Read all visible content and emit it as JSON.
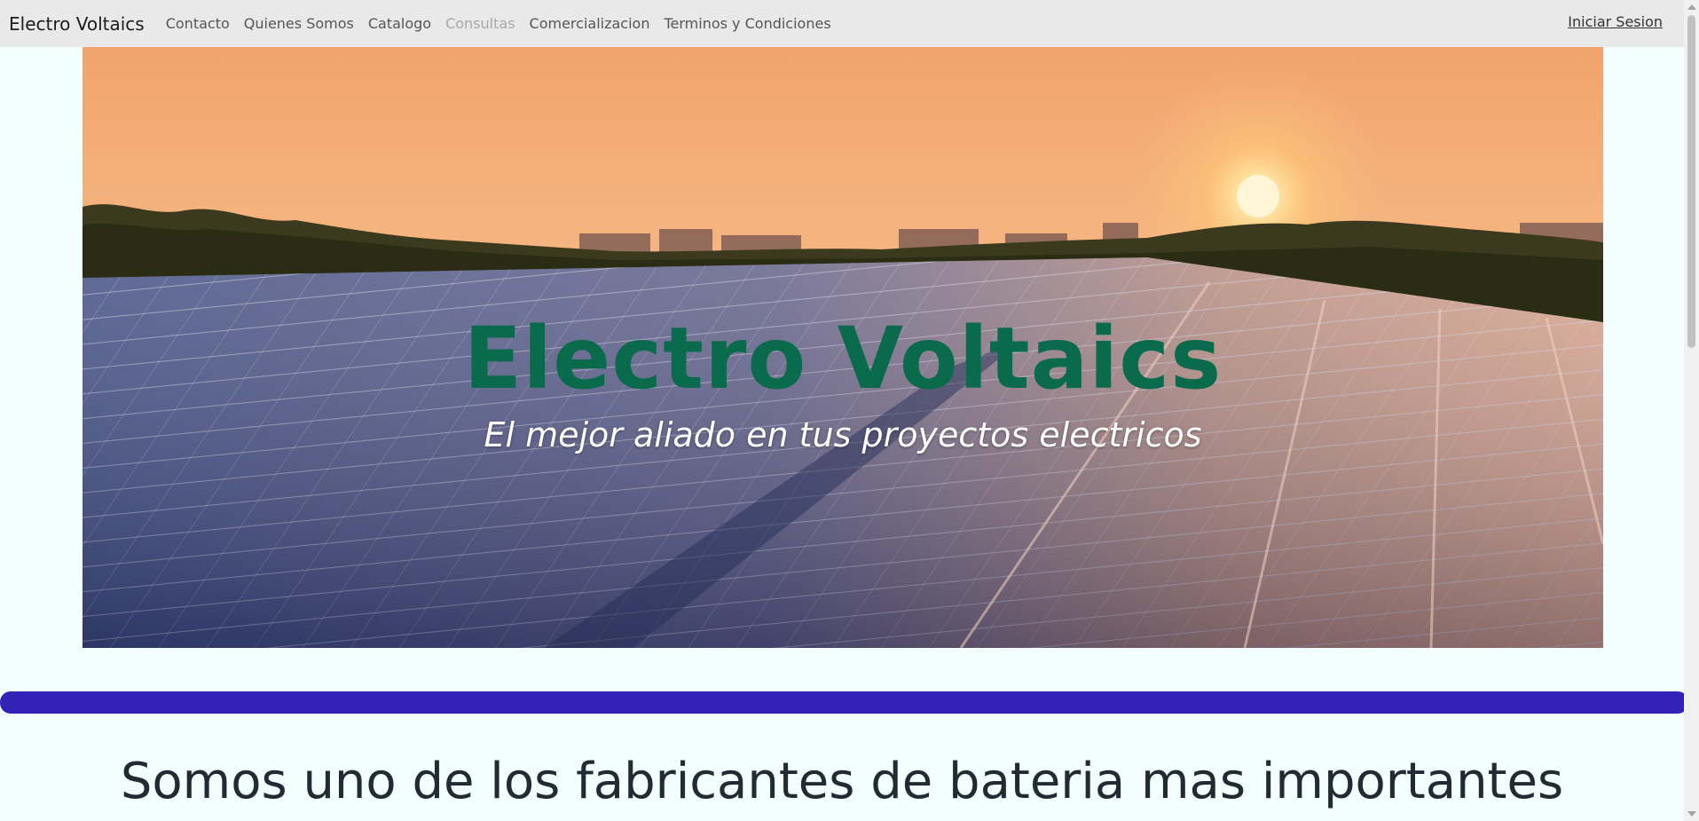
{
  "navbar": {
    "brand": "Electro Voltaics",
    "links": [
      {
        "label": "Contacto",
        "disabled": false
      },
      {
        "label": "Quienes Somos",
        "disabled": false
      },
      {
        "label": "Catalogo",
        "disabled": false
      },
      {
        "label": "Consultas",
        "disabled": true
      },
      {
        "label": "Comercializacion",
        "disabled": false
      },
      {
        "label": "Terminos y Condiciones",
        "disabled": false
      }
    ],
    "login_label": "Iniciar Sesion"
  },
  "hero": {
    "title": "Electro Voltaics",
    "subtitle": "El mejor aliado en tus proyectos electricos",
    "image": "sunset-solar-panels-photo"
  },
  "headline": "Somos uno de los fabricantes de bateria mas importantes",
  "colors": {
    "navbar_bg": "#e9e9e9",
    "page_bg": "#f3fffe",
    "title_green": "#0a6b4c",
    "accent_bar": "#3322b6",
    "headline_text": "#222a33"
  }
}
